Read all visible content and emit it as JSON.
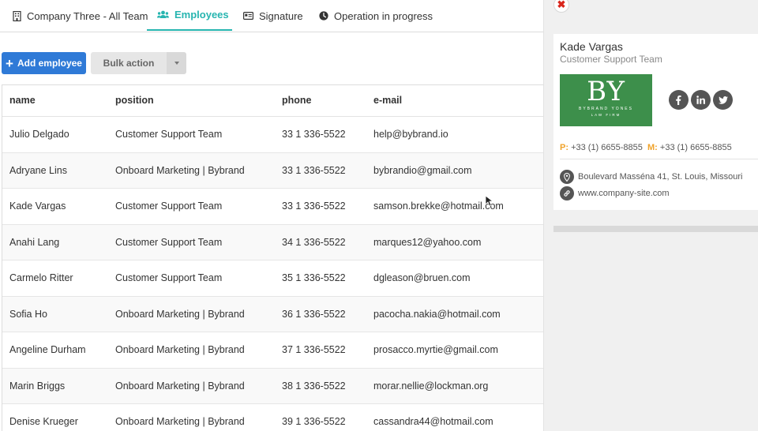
{
  "tabs": [
    {
      "label": "Company Three - All Team",
      "icon": "building-icon"
    },
    {
      "label": "Employees",
      "icon": "users-icon"
    },
    {
      "label": "Signature",
      "icon": "id-card-icon"
    },
    {
      "label": "Operation in progress",
      "icon": "clock-icon"
    }
  ],
  "toolbar": {
    "add_label": "Add employee",
    "bulk_label": "Bulk action"
  },
  "table": {
    "headers": [
      "name",
      "position",
      "phone",
      "e-mail"
    ],
    "rows": [
      {
        "name": "Julio Delgado",
        "position": "Customer Support Team",
        "phone": "33 1 336-5522",
        "email": "help@bybrand.io"
      },
      {
        "name": "Adryane Lins",
        "position": "Onboard Marketing | Bybrand",
        "phone": "33 1 336-5522",
        "email": "bybrandio@gmail.com"
      },
      {
        "name": "Kade Vargas",
        "position": "Customer Support Team",
        "phone": "33 1 336-5522",
        "email": "samson.brekke@hotmail.com"
      },
      {
        "name": "Anahi Lang",
        "position": "Customer Support Team",
        "phone": "34 1 336-5522",
        "email": "marques12@yahoo.com"
      },
      {
        "name": "Carmelo Ritter",
        "position": "Customer Support Team",
        "phone": "35 1 336-5522",
        "email": "dgleason@bruen.com"
      },
      {
        "name": "Sofia Ho",
        "position": "Onboard Marketing | Bybrand",
        "phone": "36 1 336-5522",
        "email": "pacocha.nakia@hotmail.com"
      },
      {
        "name": "Angeline Durham",
        "position": "Onboard Marketing | Bybrand",
        "phone": "37 1 336-5522",
        "email": "prosacco.myrtie@gmail.com"
      },
      {
        "name": "Marin Briggs",
        "position": "Onboard Marketing | Bybrand",
        "phone": "38 1 336-5522",
        "email": "morar.nellie@lockman.org"
      },
      {
        "name": "Denise Krueger",
        "position": "Onboard Marketing | Bybrand",
        "phone": "39 1 336-5522",
        "email": "cassandra44@hotmail.com"
      }
    ]
  },
  "preview": {
    "close_icon": "close-icon",
    "name": "Kade Vargas",
    "title": "Customer Support Team",
    "logo": {
      "monogram": "BY",
      "line1": "BYBRAND YONES",
      "line2": "LAW FIRM",
      "color": "#3d8f4b"
    },
    "social": [
      "facebook-icon",
      "linkedin-icon",
      "twitter-icon"
    ],
    "phone_label": "P:",
    "phone": "+33 (1) 6655-8855",
    "mobile_label": "M:",
    "mobile": "+33 (1) 6655-8855",
    "address": "Boulevard Masséna 41, St. Louis, Missouri",
    "website": "www.company-site.com"
  },
  "colors": {
    "accent": "#27b5b0",
    "primary_button": "#2f7ad7",
    "label_orange": "#f0a32a",
    "close_red": "#d9261c"
  }
}
